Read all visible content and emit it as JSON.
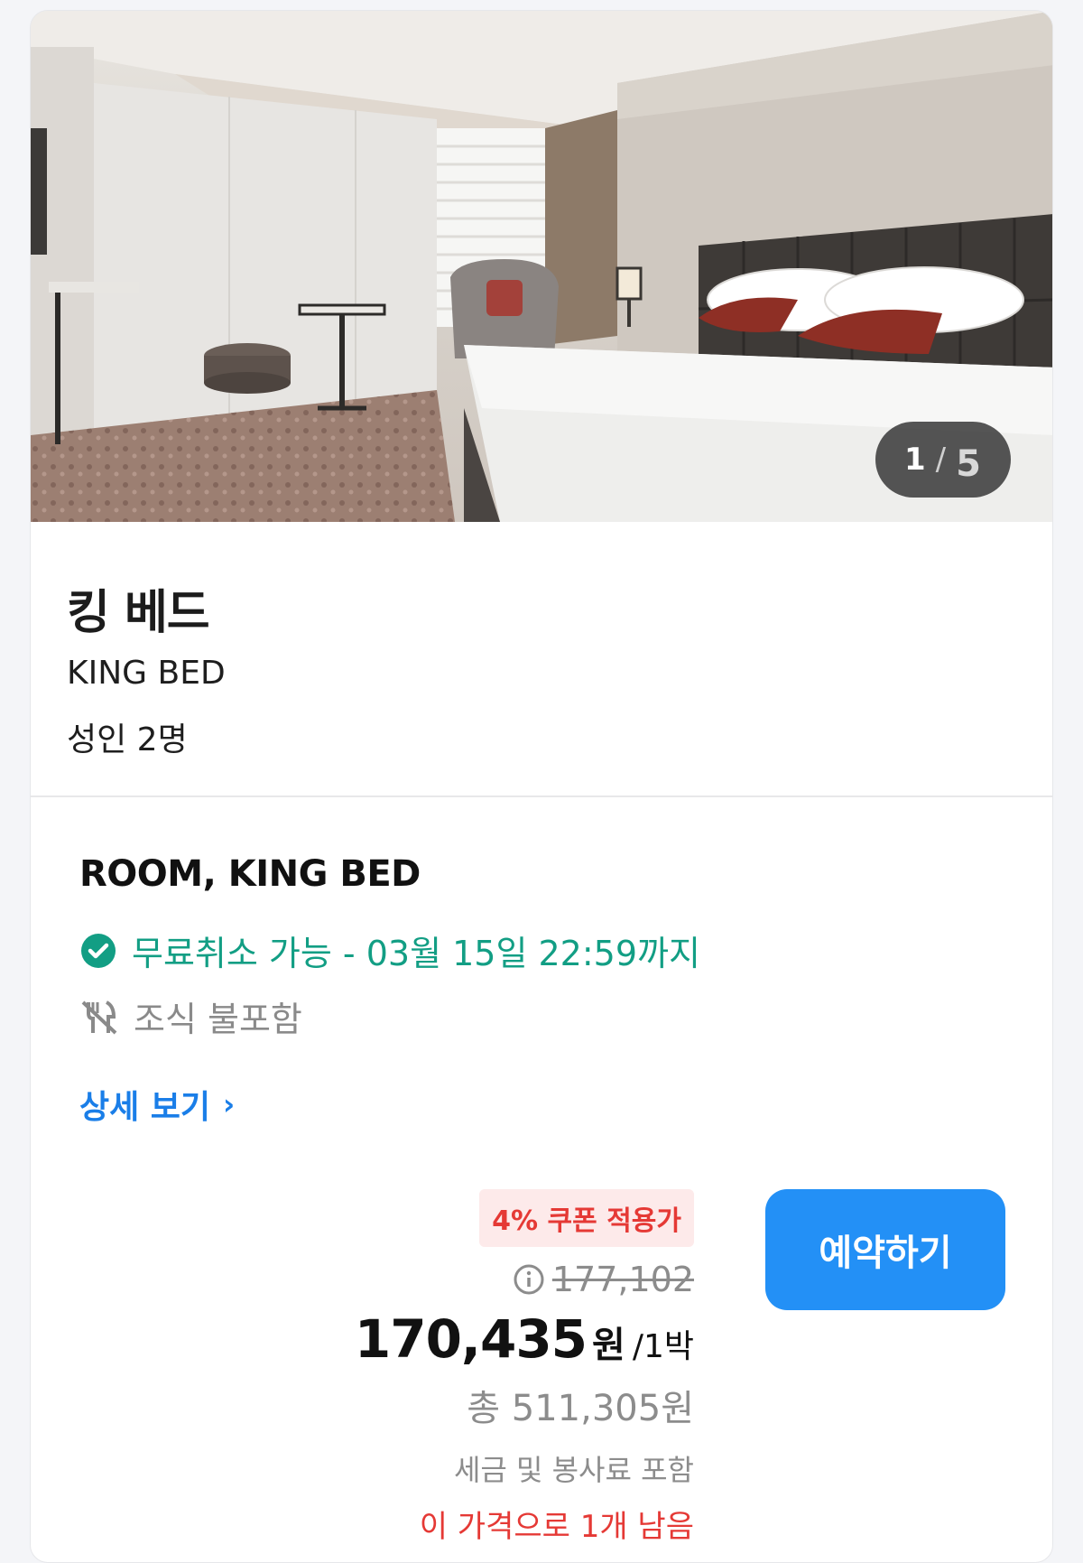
{
  "gallery": {
    "current": "1",
    "separator": "/",
    "total": "5"
  },
  "room": {
    "name_ko": "킹 베드",
    "name_en": "KING BED",
    "occupancy": "성인 2명"
  },
  "rate": {
    "name": "ROOM, KING BED",
    "cancellation": "무료취소 가능 - 03월 15일 22:59까지",
    "breakfast": "조식 불포함",
    "detail_link": "상세 보기",
    "coupon_badge": "4% 쿠폰 적용가",
    "original_price": "177,102",
    "final_price": "170,435",
    "currency": "원",
    "per_night": "/1박",
    "total": "총 511,305원",
    "tax_note": "세금 및 봉사료 포함",
    "availability": "이 가격으로 1개 남음",
    "book_button": "예약하기"
  },
  "icons": {
    "cancel": "check-circle-icon",
    "breakfast": "no-meal-icon",
    "info": "info-icon",
    "chevron": "chevron-right-icon"
  },
  "colors": {
    "accent_blue": "#2390f6",
    "success_green": "#129e84",
    "alert_red": "#e53935",
    "coupon_bg": "#fdeaea",
    "muted_gray": "#8c8c8c"
  }
}
